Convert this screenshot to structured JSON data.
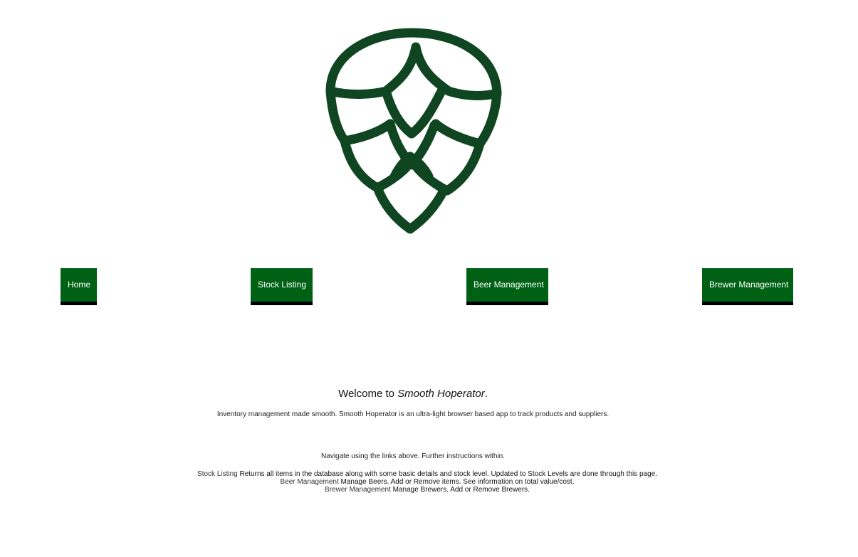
{
  "brand": {
    "logo_icon": "hop-cone-icon",
    "logo_color": "#0f4520",
    "accent_color": "#006114"
  },
  "nav": {
    "items": [
      {
        "label": "Home"
      },
      {
        "label": "Stock Listing"
      },
      {
        "label": "Beer Management"
      },
      {
        "label": "Brewer Management"
      }
    ]
  },
  "main": {
    "welcome_prefix": "Welcome to ",
    "app_name": "Smooth Hoperator",
    "welcome_suffix": ".",
    "tagline": "Inventory management made smooth. Smooth Hoperator is an ultra-light browser based app to track products and suppliers.",
    "navigate_text": "Navigate using the links above. Further instructions within.",
    "instructions": [
      {
        "name": "Stock Listing",
        "text": " Returns all items in the database along with some basic details and stock level. Updated to Stock Levels are done through this page."
      },
      {
        "name": "Beer Management",
        "text": " Manage Beers. Add or Remove items. See information on total value/cost."
      },
      {
        "name": "Brewer Management",
        "text": " Manage Brewers. Add or Remove Brewers."
      }
    ]
  }
}
